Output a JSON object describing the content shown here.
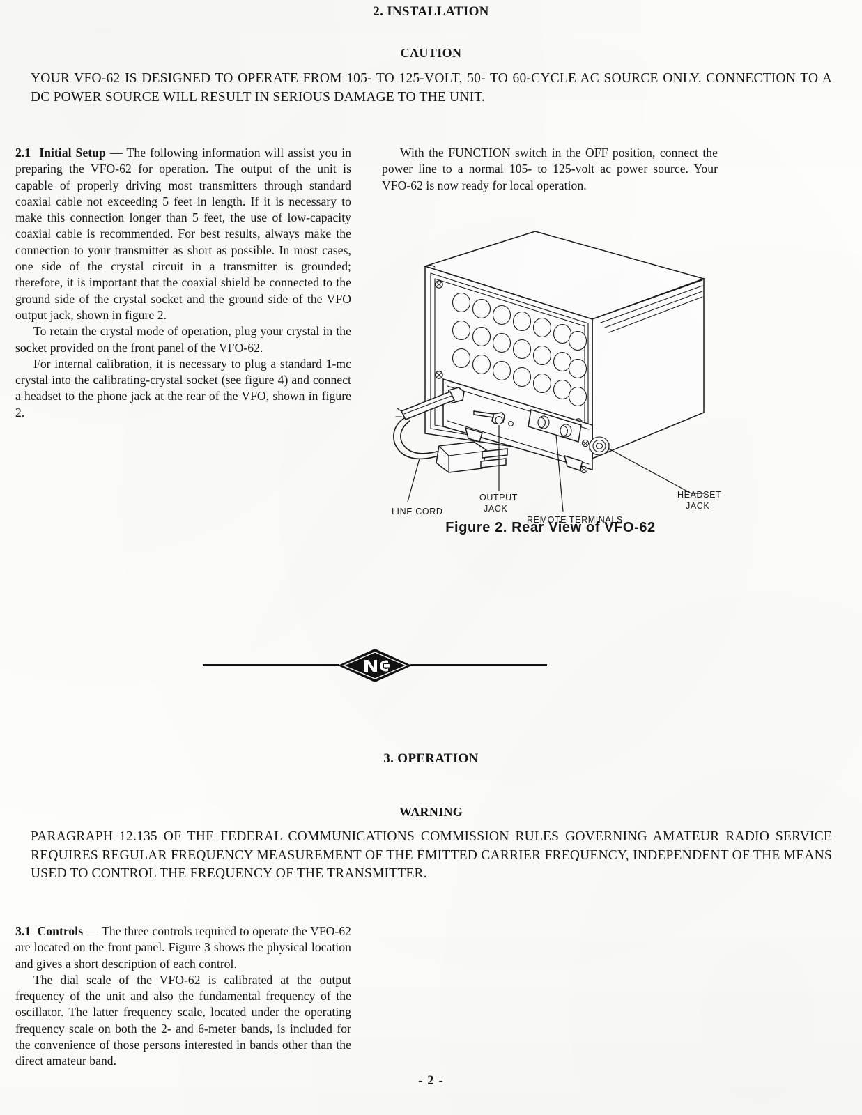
{
  "page": {
    "chapter_title": "2. INSTALLATION",
    "footer": "- 2 -"
  },
  "caution": {
    "heading": "CAUTION",
    "body": "YOUR VFO-62 IS DESIGNED TO OPERATE FROM 105- TO 125-VOLT, 50- TO 60-CYCLE AC SOURCE ONLY. CONNECTION TO A DC POWER SOURCE WILL RESULT IN SERIOUS DAMAGE TO THE UNIT."
  },
  "section_2_1": {
    "number": "2.1",
    "title": "Initial Setup",
    "dash": "—",
    "para1": "The following information will assist you in preparing the VFO-62 for operation. The output of the unit is capable of properly driving most transmitters through standard coaxial cable not exceeding 5 feet in length. If it is necessary to make this connection longer than 5 feet, the use of low-capacity coaxial cable is recommended. For best results, always make the connection to your transmitter as short as possible. In most cases, one side of the crystal circuit in a transmitter is grounded; therefore, it is important that the coaxial shield be connected to the ground side of the crystal socket and the ground side of the VFO output jack, shown in figure 2.",
    "para2": "To retain the crystal mode of operation, plug your crystal in the socket provided on the front panel of the VFO-62.",
    "para3": "For internal calibration, it is necessary to plug a standard 1-mc crystal into the calibrating-crystal socket (see figure 4) and connect a headset to the phone jack at the rear of the VFO, shown in figure 2.",
    "para4": "With the FUNCTION switch in the OFF position, connect the power line to a normal 105- to 125-volt ac power source. Your VFO-62 is now ready for local operation."
  },
  "figure_2": {
    "caption": "Figure 2.   Rear View of VFO-62",
    "callouts": {
      "line_cord": "LINE CORD",
      "output_jack_l1": "OUTPUT",
      "output_jack_l2": "JACK",
      "remote_terminals": "REMOTE  TERMINALS",
      "headset_jack_l1": "HEADSET",
      "headset_jack_l2": "JACK"
    }
  },
  "divider": {
    "logo_text": "NC"
  },
  "section_3": {
    "heading": "3. OPERATION"
  },
  "warning": {
    "heading": "WARNING",
    "body": "PARAGRAPH 12.135 OF THE FEDERAL COMMUNICATIONS COMMISSION RULES GOVERNING AMATEUR RADIO SERVICE REQUIRES REGULAR FREQUENCY MEASUREMENT OF THE EMITTED CARRIER FREQUENCY, INDEPENDENT OF THE MEANS USED TO CONTROL THE FREQUENCY OF THE TRANSMITTER."
  },
  "section_3_1": {
    "number": "3.1",
    "title": "Controls",
    "dash": "—",
    "para1": "The three controls required to operate the VFO-62 are located on the front panel. Figure 3 shows the physical location and gives a short description of each control.",
    "para2": "The dial scale of the VFO-62 is calibrated at the output frequency of the unit and also the fundamental frequency of the oscillator. The latter frequency scale, located under the operating frequency scale on both the 2- and 6-meter bands, is included for the convenience of those persons interested in bands other than the direct amateur band."
  }
}
